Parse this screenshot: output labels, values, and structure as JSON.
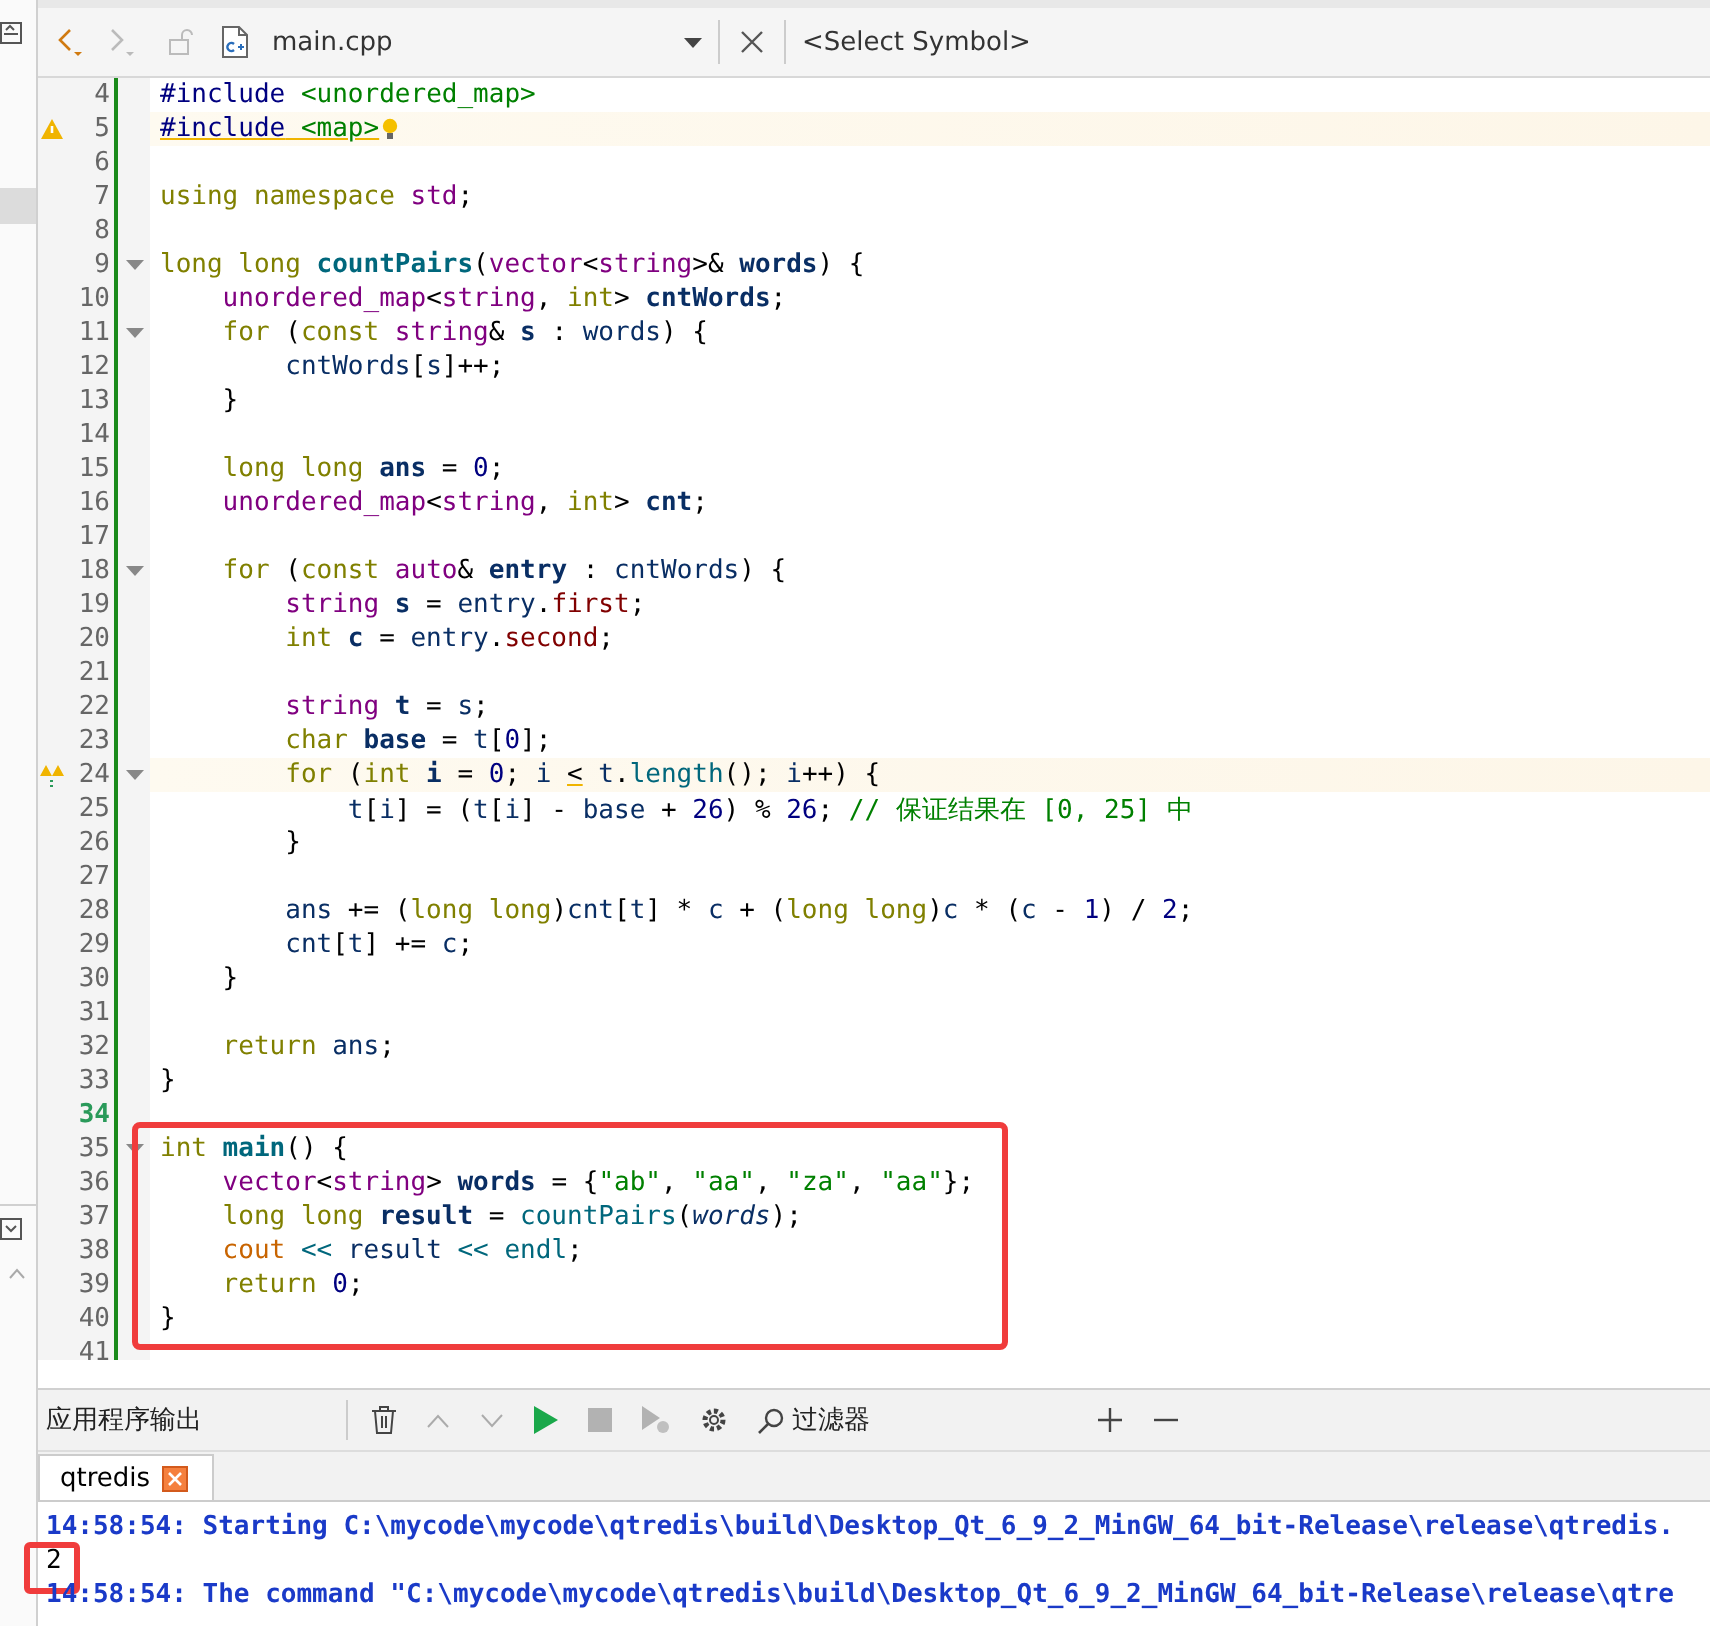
{
  "toolbar": {
    "nav": [
      {
        "kind": "back",
        "disabled": false
      },
      {
        "kind": "forward",
        "disabled": true
      }
    ],
    "file_name": "main.cpp",
    "symbol_selector": "<Select Symbol>"
  },
  "editor": {
    "lines": [
      {
        "number": "4",
        "tokens": [
          {
            "kind": "mac",
            "text": "#include"
          },
          {
            "kind": "inc",
            "text": " <unordered_map>"
          }
        ]
      },
      {
        "number": "5",
        "warning": true,
        "bulb": true,
        "tokens": [
          {
            "kind": "mac",
            "text": "#include",
            "underline": true
          },
          {
            "kind": "inc",
            "text": " <map>",
            "underline": true
          }
        ]
      },
      {
        "number": "6"
      },
      {
        "number": "7",
        "tokens": [
          {
            "kind": "kw",
            "text": "using"
          },
          {
            "kind": "kw",
            "text": " namespace"
          },
          {
            "kind": "type",
            "text": " std"
          },
          {
            "kind": "p",
            "text": ";"
          }
        ]
      },
      {
        "number": "8"
      },
      {
        "number": "9",
        "fold": true,
        "tokens": [
          {
            "kind": "kw",
            "text": "long long"
          },
          {
            "kind": "fnb",
            "text": " countPairs"
          },
          {
            "kind": "p",
            "text": "("
          },
          {
            "kind": "type",
            "text": "vector"
          },
          {
            "kind": "p",
            "text": "<"
          },
          {
            "kind": "type",
            "text": "string"
          },
          {
            "kind": "p",
            "text": ">&"
          },
          {
            "kind": "decl",
            "text": " words"
          },
          {
            "kind": "p",
            "text": ") {"
          }
        ]
      },
      {
        "number": "10",
        "tokens": [
          {
            "kind": "type",
            "text": "    unordered_map"
          },
          {
            "kind": "p",
            "text": "<"
          },
          {
            "kind": "type",
            "text": "string"
          },
          {
            "kind": "p",
            "text": ","
          },
          {
            "kind": "kw",
            "text": " int"
          },
          {
            "kind": "p",
            "text": ">"
          },
          {
            "kind": "decl",
            "text": " cntWords"
          },
          {
            "kind": "p",
            "text": ";"
          }
        ]
      },
      {
        "number": "11",
        "fold": true,
        "tokens": [
          {
            "kind": "kw",
            "text": "    for"
          },
          {
            "kind": "p",
            "text": " ("
          },
          {
            "kind": "kw",
            "text": "const"
          },
          {
            "kind": "type",
            "text": " string"
          },
          {
            "kind": "p",
            "text": "&"
          },
          {
            "kind": "decl",
            "text": " s"
          },
          {
            "kind": "p",
            "text": " :"
          },
          {
            "kind": "id",
            "text": " words"
          },
          {
            "kind": "p",
            "text": ") {"
          }
        ]
      },
      {
        "number": "12",
        "tokens": [
          {
            "kind": "id",
            "text": "        cntWords"
          },
          {
            "kind": "p",
            "text": "["
          },
          {
            "kind": "id",
            "text": "s"
          },
          {
            "kind": "p",
            "text": "]++;"
          }
        ]
      },
      {
        "number": "13",
        "tokens": [
          {
            "kind": "p",
            "text": "    }"
          }
        ]
      },
      {
        "number": "14"
      },
      {
        "number": "15",
        "tokens": [
          {
            "kind": "kw",
            "text": "    long long"
          },
          {
            "kind": "decl",
            "text": " ans"
          },
          {
            "kind": "p",
            "text": " ="
          },
          {
            "kind": "num",
            "text": " 0"
          },
          {
            "kind": "p",
            "text": ";"
          }
        ]
      },
      {
        "number": "16",
        "tokens": [
          {
            "kind": "type",
            "text": "    unordered_map"
          },
          {
            "kind": "p",
            "text": "<"
          },
          {
            "kind": "type",
            "text": "string"
          },
          {
            "kind": "p",
            "text": ","
          },
          {
            "kind": "kw",
            "text": " int"
          },
          {
            "kind": "p",
            "text": ">"
          },
          {
            "kind": "decl",
            "text": " cnt"
          },
          {
            "kind": "p",
            "text": ";"
          }
        ]
      },
      {
        "number": "17"
      },
      {
        "number": "18",
        "fold": true,
        "tokens": [
          {
            "kind": "kw",
            "text": "    for"
          },
          {
            "kind": "p",
            "text": " ("
          },
          {
            "kind": "kw",
            "text": "const"
          },
          {
            "kind": "type",
            "text": " auto"
          },
          {
            "kind": "p",
            "text": "&"
          },
          {
            "kind": "decl",
            "text": " entry"
          },
          {
            "kind": "p",
            "text": " :"
          },
          {
            "kind": "id",
            "text": " cntWords"
          },
          {
            "kind": "p",
            "text": ") {"
          }
        ]
      },
      {
        "number": "19",
        "tokens": [
          {
            "kind": "type",
            "text": "        string"
          },
          {
            "kind": "decl",
            "text": " s"
          },
          {
            "kind": "p",
            "text": " ="
          },
          {
            "kind": "id",
            "text": " entry"
          },
          {
            "kind": "p",
            "text": "."
          },
          {
            "kind": "mem",
            "text": "first"
          },
          {
            "kind": "p",
            "text": ";"
          }
        ]
      },
      {
        "number": "20",
        "tokens": [
          {
            "kind": "kw",
            "text": "        int"
          },
          {
            "kind": "decl",
            "text": " c"
          },
          {
            "kind": "p",
            "text": " ="
          },
          {
            "kind": "id",
            "text": " entry"
          },
          {
            "kind": "p",
            "text": "."
          },
          {
            "kind": "mem",
            "text": "second"
          },
          {
            "kind": "p",
            "text": ";"
          }
        ]
      },
      {
        "number": "21"
      },
      {
        "number": "22",
        "tokens": [
          {
            "kind": "type",
            "text": "        string"
          },
          {
            "kind": "decl",
            "text": " t"
          },
          {
            "kind": "p",
            "text": " ="
          },
          {
            "kind": "id",
            "text": " s"
          },
          {
            "kind": "p",
            "text": ";"
          }
        ]
      },
      {
        "number": "23",
        "tokens": [
          {
            "kind": "kw",
            "text": "        char"
          },
          {
            "kind": "decl",
            "text": " base"
          },
          {
            "kind": "p",
            "text": " ="
          },
          {
            "kind": "id",
            "text": " t"
          },
          {
            "kind": "p",
            "text": "["
          },
          {
            "kind": "num",
            "text": "0"
          },
          {
            "kind": "p",
            "text": "];"
          }
        ]
      },
      {
        "number": "24",
        "fold": true,
        "warning": true,
        "multiple": true,
        "tokens": [
          {
            "kind": "kw",
            "text": "        for"
          },
          {
            "kind": "p",
            "text": " ("
          },
          {
            "kind": "kw",
            "text": "int"
          },
          {
            "kind": "decl",
            "text": " i"
          },
          {
            "kind": "p",
            "text": " ="
          },
          {
            "kind": "num",
            "text": " 0"
          },
          {
            "kind": "p",
            "text": ";"
          },
          {
            "kind": "id",
            "text": " i "
          },
          {
            "kind": "p",
            "text": "<",
            "underline": true
          },
          {
            "kind": "id",
            "text": " t"
          },
          {
            "kind": "p",
            "text": "."
          },
          {
            "kind": "fn",
            "text": "length"
          },
          {
            "kind": "p",
            "text": "();"
          },
          {
            "kind": "id",
            "text": " i"
          },
          {
            "kind": "p",
            "text": "++) {"
          }
        ]
      },
      {
        "number": "25",
        "tokens": [
          {
            "kind": "id",
            "text": "            t"
          },
          {
            "kind": "p",
            "text": "["
          },
          {
            "kind": "id",
            "text": "i"
          },
          {
            "kind": "p",
            "text": "] = ("
          },
          {
            "kind": "id",
            "text": "t"
          },
          {
            "kind": "p",
            "text": "["
          },
          {
            "kind": "id",
            "text": "i"
          },
          {
            "kind": "p",
            "text": "] -"
          },
          {
            "kind": "id",
            "text": " base"
          },
          {
            "kind": "p",
            "text": " +"
          },
          {
            "kind": "num",
            "text": " 26"
          },
          {
            "kind": "p",
            "text": ") %"
          },
          {
            "kind": "num",
            "text": " 26"
          },
          {
            "kind": "p",
            "text": ";"
          },
          {
            "kind": "com",
            "text": " // 保证结果在 [0, 25] 中"
          }
        ]
      },
      {
        "number": "26",
        "tokens": [
          {
            "kind": "p",
            "text": "        }"
          }
        ]
      },
      {
        "number": "27"
      },
      {
        "number": "28",
        "tokens": [
          {
            "kind": "id",
            "text": "        ans"
          },
          {
            "kind": "p",
            "text": " += ("
          },
          {
            "kind": "kw",
            "text": "long long"
          },
          {
            "kind": "p",
            "text": ")"
          },
          {
            "kind": "id",
            "text": "cnt"
          },
          {
            "kind": "p",
            "text": "["
          },
          {
            "kind": "id",
            "text": "t"
          },
          {
            "kind": "p",
            "text": "] *"
          },
          {
            "kind": "id",
            "text": " c"
          },
          {
            "kind": "p",
            "text": " + ("
          },
          {
            "kind": "kw",
            "text": "long long"
          },
          {
            "kind": "p",
            "text": ")"
          },
          {
            "kind": "id",
            "text": "c"
          },
          {
            "kind": "p",
            "text": " * ("
          },
          {
            "kind": "id",
            "text": "c"
          },
          {
            "kind": "p",
            "text": " -"
          },
          {
            "kind": "num",
            "text": " 1"
          },
          {
            "kind": "p",
            "text": ") /"
          },
          {
            "kind": "num",
            "text": " 2"
          },
          {
            "kind": "p",
            "text": ";"
          }
        ]
      },
      {
        "number": "29",
        "tokens": [
          {
            "kind": "id",
            "text": "        cnt"
          },
          {
            "kind": "p",
            "text": "["
          },
          {
            "kind": "id",
            "text": "t"
          },
          {
            "kind": "p",
            "text": "] +="
          },
          {
            "kind": "id",
            "text": " c"
          },
          {
            "kind": "p",
            "text": ";"
          }
        ]
      },
      {
        "number": "30",
        "tokens": [
          {
            "kind": "p",
            "text": "    }"
          }
        ]
      },
      {
        "number": "31"
      },
      {
        "number": "32",
        "tokens": [
          {
            "kind": "kw",
            "text": "    return"
          },
          {
            "kind": "id",
            "text": " ans"
          },
          {
            "kind": "p",
            "text": ";"
          }
        ]
      },
      {
        "number": "33",
        "tokens": [
          {
            "kind": "p",
            "text": "}"
          }
        ]
      },
      {
        "number": "34",
        "current": true
      },
      {
        "number": "35",
        "fold": true,
        "boxed": true,
        "tokens": [
          {
            "kind": "kw",
            "text": "int"
          },
          {
            "kind": "fnb",
            "text": " main"
          },
          {
            "kind": "p",
            "text": "() {"
          }
        ]
      },
      {
        "number": "36",
        "boxed": true,
        "tokens": [
          {
            "kind": "type",
            "text": "    vector"
          },
          {
            "kind": "p",
            "text": "<"
          },
          {
            "kind": "type",
            "text": "string"
          },
          {
            "kind": "p",
            "text": ">"
          },
          {
            "kind": "decl",
            "text": " words"
          },
          {
            "kind": "p",
            "text": " = {"
          },
          {
            "kind": "str",
            "text": "\"ab\""
          },
          {
            "kind": "p",
            "text": ","
          },
          {
            "kind": "str",
            "text": " \"aa\""
          },
          {
            "kind": "p",
            "text": ","
          },
          {
            "kind": "str",
            "text": " \"za\""
          },
          {
            "kind": "p",
            "text": ","
          },
          {
            "kind": "str",
            "text": " \"aa\""
          },
          {
            "kind": "p",
            "text": "};"
          }
        ]
      },
      {
        "number": "37",
        "boxed": true,
        "tokens": [
          {
            "kind": "kw",
            "text": "    long long"
          },
          {
            "kind": "decl",
            "text": " result"
          },
          {
            "kind": "p",
            "text": " ="
          },
          {
            "kind": "fn",
            "text": " countPairs"
          },
          {
            "kind": "p",
            "text": "("
          },
          {
            "kind": "it",
            "text": "words"
          },
          {
            "kind": "p",
            "text": ");"
          }
        ]
      },
      {
        "number": "38",
        "boxed": true,
        "tokens": [
          {
            "kind": "out",
            "text": "    cout"
          },
          {
            "kind": "op",
            "text": " <<"
          },
          {
            "kind": "id",
            "text": " result"
          },
          {
            "kind": "op",
            "text": " <<"
          },
          {
            "kind": "fn",
            "text": " endl"
          },
          {
            "kind": "p",
            "text": ";"
          }
        ]
      },
      {
        "number": "39",
        "boxed": true,
        "tokens": [
          {
            "kind": "kw",
            "text": "    return"
          },
          {
            "kind": "num",
            "text": " 0"
          },
          {
            "kind": "p",
            "text": ";"
          }
        ]
      },
      {
        "number": "40",
        "boxed": true,
        "tokens": [
          {
            "kind": "p",
            "text": "}"
          }
        ]
      },
      {
        "number": "41"
      }
    ]
  },
  "output_panel": {
    "title": "应用程序输出",
    "tools": [
      {
        "kind": "clear",
        "disabled": false
      },
      {
        "kind": "up",
        "disabled": true
      },
      {
        "kind": "down",
        "disabled": true
      },
      {
        "kind": "run",
        "disabled": false
      },
      {
        "kind": "stop",
        "disabled": true
      },
      {
        "kind": "debug",
        "disabled": true
      },
      {
        "kind": "settings",
        "disabled": false
      }
    ],
    "filter_placeholder": "过滤器",
    "tabs": [
      {
        "label": "qtredis",
        "selected": true
      }
    ],
    "lines": [
      {
        "kind": "message",
        "text": "14:58:54: Starting C:\\mycode\\mycode\\qtredis\\build\\Desktop_Qt_6_9_2_MinGW_64_bit-Release\\release\\qtredis."
      },
      {
        "kind": "stdout",
        "text": "2",
        "boxed": true
      },
      {
        "kind": "message",
        "text": "14:58:54: The command \"C:\\mycode\\mycode\\qtredis\\build\\Desktop_Qt_6_9_2_MinGW_64_bit-Release\\release\\qtre"
      }
    ]
  }
}
